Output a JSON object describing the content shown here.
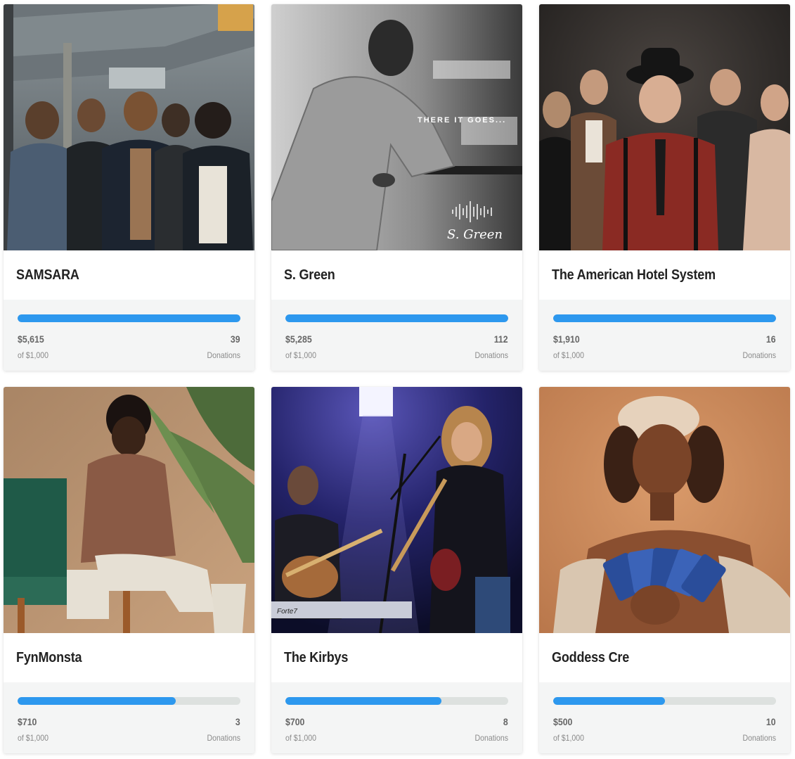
{
  "campaigns": [
    {
      "name": "SAMSARA",
      "raised": "$5,615",
      "goal": "of $1,000",
      "donations": "39",
      "donations_label": "Donations",
      "progress": 1.0,
      "photo": "band-under-bridge-photo",
      "bg": "#5b6166"
    },
    {
      "name": "S. Green",
      "raised": "$5,285",
      "goal": "of $1,000",
      "donations": "112",
      "donations_label": "Donations",
      "progress": 1.0,
      "photo": "album-cover-photo",
      "bg": "#7a7a7a",
      "photo_text": {
        "caption": "THERE IT GOES...",
        "signature": "S. Green"
      }
    },
    {
      "name": "The American Hotel System",
      "raised": "$1,910",
      "goal": "of $1,000",
      "donations": "16",
      "donations_label": "Donations",
      "progress": 1.0,
      "photo": "band-portrait-photo",
      "bg": "#2a2624"
    },
    {
      "name": "FynMonsta",
      "raised": "$710",
      "goal": "of $1,000",
      "donations": "3",
      "donations_label": "Donations",
      "progress": 0.71,
      "photo": "artist-seated-photo",
      "bg": "#b7906f"
    },
    {
      "name": "The Kirbys",
      "raised": "$700",
      "goal": "of $1,000",
      "donations": "8",
      "donations_label": "Donations",
      "progress": 0.7,
      "photo": "live-stage-photo",
      "bg": "#1a1d52",
      "photo_text": {
        "keyboard_brand": "Forte7"
      }
    },
    {
      "name": "Goddess Cre",
      "raised": "$500",
      "goal": "of $1,000",
      "donations": "10",
      "donations_label": "Donations",
      "progress": 0.5,
      "photo": "artist-portrait-photo",
      "bg": "#c98a5e"
    }
  ],
  "colors": {
    "progress_fill": "#2d98ee",
    "progress_track": "#dde1df",
    "stats_bg": "#f4f5f5"
  }
}
